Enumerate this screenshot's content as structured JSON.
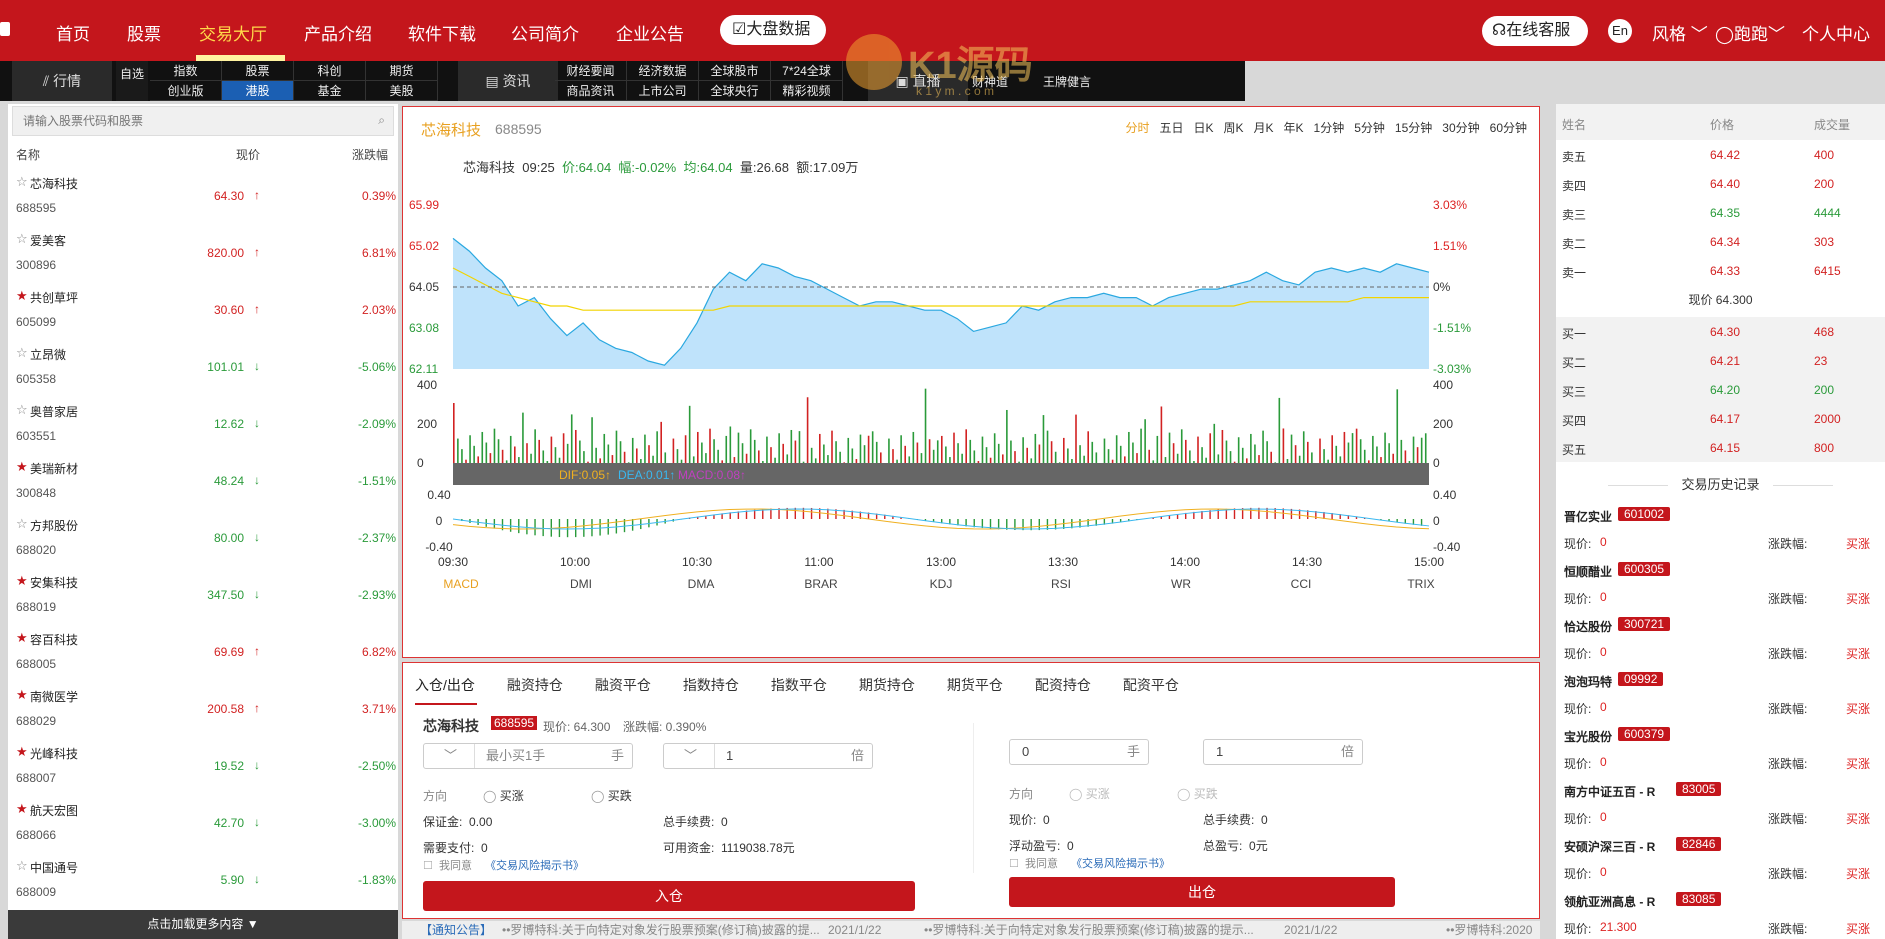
{
  "nav": {
    "items": [
      "首页",
      "股票",
      "交易大厅",
      "产品介绍",
      "软件下载",
      "公司简介",
      "企业公告"
    ],
    "active": "交易大厅",
    "big_data": "大盘数据",
    "service": "在线客服",
    "lang": "En",
    "style": "风格",
    "user": "跑跑",
    "personal": "个人中心"
  },
  "watermark": {
    "text": "K1源码",
    "sub": "k 1 y m . c o m"
  },
  "subnav": {
    "market": "行情",
    "zixuan": "自选",
    "grid1": [
      "指数",
      "股票",
      "科创",
      "期货",
      "创业版",
      "港股",
      "基金",
      "美股"
    ],
    "news": "资讯",
    "grid2": [
      "财经要闻",
      "经济数据",
      "全球股市",
      "7*24全球",
      "商品资讯",
      "上市公司",
      "全球央行",
      "精彩视频"
    ],
    "live": "直播",
    "live_items": [
      "财神道",
      "王牌健言"
    ]
  },
  "left": {
    "search_placeholder": "请输入股票代码和股票",
    "headers": [
      "名称",
      "现价",
      "涨跌幅"
    ],
    "more": "点击加载更多内容",
    "stocks": [
      {
        "star": "☆",
        "name": "芯海科技",
        "code": "688595",
        "price": "64.30",
        "arrow": "↑",
        "change": "0.39%",
        "up": true
      },
      {
        "star": "☆",
        "name": "爱美客",
        "code": "300896",
        "price": "820.00",
        "arrow": "↑",
        "change": "6.81%",
        "up": true
      },
      {
        "star": "★",
        "name": "共创草坪",
        "code": "605099",
        "price": "30.60",
        "arrow": "↑",
        "change": "2.03%",
        "up": true
      },
      {
        "star": "☆",
        "name": "立昂微",
        "code": "605358",
        "price": "101.01",
        "arrow": "↓",
        "change": "-5.06%",
        "up": false
      },
      {
        "star": "☆",
        "name": "奥普家居",
        "code": "603551",
        "price": "12.62",
        "arrow": "↓",
        "change": "-2.09%",
        "up": false
      },
      {
        "star": "★",
        "name": "美瑞新材",
        "code": "300848",
        "price": "48.24",
        "arrow": "↓",
        "change": "-1.51%",
        "up": false
      },
      {
        "star": "☆",
        "name": "方邦股份",
        "code": "688020",
        "price": "80.00",
        "arrow": "↓",
        "change": "-2.37%",
        "up": false
      },
      {
        "star": "★",
        "name": "安集科技",
        "code": "688019",
        "price": "347.50",
        "arrow": "↓",
        "change": "-2.93%",
        "up": false
      },
      {
        "star": "★",
        "name": "容百科技",
        "code": "688005",
        "price": "69.69",
        "arrow": "↑",
        "change": "6.82%",
        "up": true
      },
      {
        "star": "★",
        "name": "南微医学",
        "code": "688029",
        "price": "200.58",
        "arrow": "↑",
        "change": "3.71%",
        "up": true
      },
      {
        "star": "★",
        "name": "光峰科技",
        "code": "688007",
        "price": "19.52",
        "arrow": "↓",
        "change": "-2.50%",
        "up": false
      },
      {
        "star": "★",
        "name": "航天宏图",
        "code": "688066",
        "price": "42.70",
        "arrow": "↓",
        "change": "-3.00%",
        "up": false
      },
      {
        "star": "☆",
        "name": "中国通号",
        "code": "688009",
        "price": "5.90",
        "arrow": "↓",
        "change": "-1.83%",
        "up": false
      }
    ]
  },
  "chart_header": {
    "name": "芯海科技",
    "code": "688595",
    "periods": [
      "分时",
      "五日",
      "日K",
      "周K",
      "月K",
      "年K",
      "1分钟",
      "5分钟",
      "15分钟",
      "30分钟",
      "60分钟"
    ],
    "active": "分时",
    "info": {
      "name": "芯海科技",
      "time": "09:25",
      "price": "价:64.04",
      "fu": "幅:-0.02%",
      "avg": "均:64.04",
      "vol": "量:26.68",
      "amt": "额:17.09万"
    }
  },
  "chart_data": {
    "type": "area",
    "x_ticks": [
      "09:30",
      "10:00",
      "10:30",
      "11:00",
      "13:00",
      "13:30",
      "14:00",
      "14:30",
      "15:00"
    ],
    "y_left": [
      "65.99",
      "65.02",
      "64.05",
      "63.08",
      "62.11"
    ],
    "y_right": [
      "3.03%",
      "1.51%",
      "0%",
      "-1.51%",
      "-3.03%"
    ],
    "price": [
      65.2,
      64.9,
      64.5,
      64.2,
      63.6,
      63.8,
      63.3,
      62.9,
      63.2,
      62.8,
      62.6,
      62.5,
      62.3,
      62.2,
      62.6,
      63.2,
      64.0,
      64.4,
      64.2,
      64.6,
      64.5,
      64.3,
      64.2,
      64.0,
      63.8,
      63.6,
      63.7,
      63.7,
      63.6,
      63.5,
      63.5,
      63.3,
      63.0,
      63.1,
      63.2,
      63.6,
      63.5,
      63.7,
      63.8,
      63.8,
      63.9,
      63.8,
      63.8,
      63.6,
      63.8,
      63.9,
      64.0,
      64.0,
      64.1,
      64.2,
      64.4,
      64.2,
      64.1,
      64.4,
      64.5,
      64.4,
      64.5,
      64.4,
      64.6,
      64.5,
      64.4
    ],
    "avg": [
      64.5,
      64.3,
      64.1,
      63.9,
      63.8,
      63.7,
      63.6,
      63.6,
      63.5,
      63.5,
      63.5,
      63.5,
      63.5,
      63.5,
      63.5,
      63.5,
      63.5,
      63.6,
      63.6,
      63.6,
      63.6,
      63.6,
      63.6,
      63.6,
      63.6,
      63.6,
      63.6,
      63.6,
      63.6,
      63.6,
      63.6,
      63.6,
      63.6,
      63.6,
      63.6,
      63.6,
      63.6,
      63.6,
      63.6,
      63.6,
      63.6,
      63.6,
      63.6,
      63.6,
      63.6,
      63.6,
      63.6,
      63.6,
      63.6,
      63.7,
      63.7,
      63.7,
      63.7,
      63.7,
      63.7,
      63.7,
      63.8,
      63.8,
      63.8,
      63.8,
      63.8
    ],
    "vol_ticks": [
      "400",
      "200",
      "0"
    ],
    "macd_ticks": [
      "0.40",
      "0",
      "-0.40"
    ],
    "macd_legend": {
      "dif": "DIF:0.05↑",
      "dea": "DEA:0.01↑",
      "macd": "MACD:0.08↑"
    },
    "indicators": [
      "MACD",
      "DMI",
      "DMA",
      "BRAR",
      "KDJ",
      "RSI",
      "WR",
      "CCI",
      "TRIX"
    ]
  },
  "trade": {
    "tabs": [
      "入仓/出仓",
      "融资持仓",
      "融资平仓",
      "指数持仓",
      "指数平仓",
      "期货持仓",
      "期货平仓",
      "配资持仓",
      "配资平仓"
    ],
    "stock_name": "芯海科技",
    "stock_code": "688595",
    "price_label": "现价: 64.300",
    "change_label": "涨跌幅: 0.390%",
    "lot_placeholder": "最小买1手",
    "lot_unit": "手",
    "mult_val": "1",
    "mult_unit": "倍",
    "direction": "方向",
    "buy_up": "买涨",
    "buy_down": "买跌",
    "margin": "保证金:",
    "margin_val": "0.00",
    "fee": "总手续费:",
    "fee_val": "0",
    "need": "需要支付:",
    "need_val": "0",
    "available": "可用资金:",
    "available_val": "1119038.78元",
    "agree": "我同意",
    "agree_link": "《交易风险揭示书》",
    "in_btn": "入仓",
    "r_lot_val": "0",
    "r_mult_val": "1",
    "r_price": "现价:",
    "r_price_val": "0",
    "r_fee": "总手续费:",
    "r_fee_val": "0",
    "r_float": "浮动盈亏:",
    "r_float_val": "0",
    "r_total": "总盈亏:",
    "r_total_val": "0元",
    "out_btn": "出仓"
  },
  "notice": {
    "label": "【通知公告】",
    "text1": "••罗博特科:关于向特定对象发行股票预案(修订稿)披露的提...",
    "date1": "2021/1/22",
    "text2": "••罗博特科:关于向特定对象发行股票预案(修订稿)披露的提示...",
    "date2": "2021/1/22",
    "text3": "••罗博特科:2020"
  },
  "orderbook": {
    "headers": [
      "姓名",
      "价格",
      "成交量"
    ],
    "sells": [
      {
        "n": "卖五",
        "p": "64.42",
        "v": "400",
        "c": "red"
      },
      {
        "n": "卖四",
        "p": "64.40",
        "v": "200",
        "c": "red"
      },
      {
        "n": "卖三",
        "p": "64.35",
        "v": "4444",
        "c": "green"
      },
      {
        "n": "卖二",
        "p": "64.34",
        "v": "303",
        "c": "red"
      },
      {
        "n": "卖一",
        "p": "64.33",
        "v": "6415",
        "c": "red"
      }
    ],
    "current": "现价 64.300",
    "buys": [
      {
        "n": "买一",
        "p": "64.30",
        "v": "468",
        "c": "red"
      },
      {
        "n": "买二",
        "p": "64.21",
        "v": "23",
        "c": "red"
      },
      {
        "n": "买三",
        "p": "64.20",
        "v": "200",
        "c": "green"
      },
      {
        "n": "买四",
        "p": "64.17",
        "v": "2000",
        "c": "red"
      },
      {
        "n": "买五",
        "p": "64.15",
        "v": "800",
        "c": "red"
      }
    ]
  },
  "history": {
    "title": "交易历史记录",
    "price_label": "现价:",
    "change_label": "涨跌幅:",
    "action": "买涨",
    "items": [
      {
        "name": "晋亿实业",
        "code": "601002",
        "price": "0"
      },
      {
        "name": "恒顺醋业",
        "code": "600305",
        "price": "0"
      },
      {
        "name": "恰达股份",
        "code": "300721",
        "price": "0"
      },
      {
        "name": "泡泡玛特",
        "code": "09992",
        "price": "0"
      },
      {
        "name": "宝光股份",
        "code": "600379",
        "price": "0"
      },
      {
        "name": "南方中证五百 - R",
        "code": "83005",
        "price": "0"
      },
      {
        "name": "安硕沪深三百 - R",
        "code": "82846",
        "price": "0"
      },
      {
        "name": "领航亚洲高息 - R",
        "code": "83085",
        "price": "21.300"
      }
    ]
  },
  "colors": {
    "brand": "#c4161c",
    "up": "#d22222",
    "down": "#2a9a3a",
    "area": "#bfe3fb",
    "line": "#2aa8e0",
    "avg": "#f2d400"
  }
}
